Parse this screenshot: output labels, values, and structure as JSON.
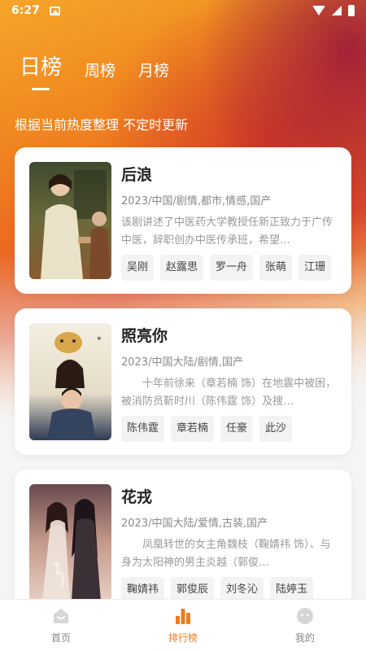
{
  "status_bar": {
    "time": "6:27"
  },
  "tabs": [
    {
      "label": "日榜",
      "active": true
    },
    {
      "label": "周榜",
      "active": false
    },
    {
      "label": "月榜",
      "active": false
    }
  ],
  "subtitle": "根据当前热度整理 不定时更新",
  "cards": [
    {
      "title": "后浪",
      "meta": "2023/中国/剧情,都市,情感,国产",
      "desc": "该剧讲述了中医药大学教授任新正致力于广传中医，辞职创办中医传承班，希望…",
      "actors": [
        "吴刚",
        "赵露思",
        "罗一舟",
        "张萌",
        "江珊"
      ]
    },
    {
      "title": "照亮你",
      "meta": "2023/中国大陆/剧情,国产",
      "desc": "十年前徐来（章若楠 饰）在地震中被困，被消防员靳时川（陈伟霆 饰）及搜…",
      "actors": [
        "陈伟霆",
        "章若楠",
        "任豪",
        "此沙"
      ]
    },
    {
      "title": "花戎",
      "meta": "2023/中国大陆/爱情,古装,国产",
      "desc": "凤凰转世的女主角魏枝（鞠婧祎 饰）、与身为太阳神的男主炎越（郭俊…",
      "actors": [
        "鞠婧祎",
        "郭俊辰",
        "刘冬沁",
        "陆婷玉"
      ]
    }
  ],
  "bottom_nav": [
    {
      "label": "首页",
      "icon": "home-icon",
      "active": false
    },
    {
      "label": "排行榜",
      "icon": "ranking-icon",
      "active": true
    },
    {
      "label": "我的",
      "icon": "profile-icon",
      "active": false
    }
  ],
  "colors": {
    "accent": "#f07a1e",
    "hero_orange": "#ec6a20",
    "hero_red": "#c8283c"
  }
}
